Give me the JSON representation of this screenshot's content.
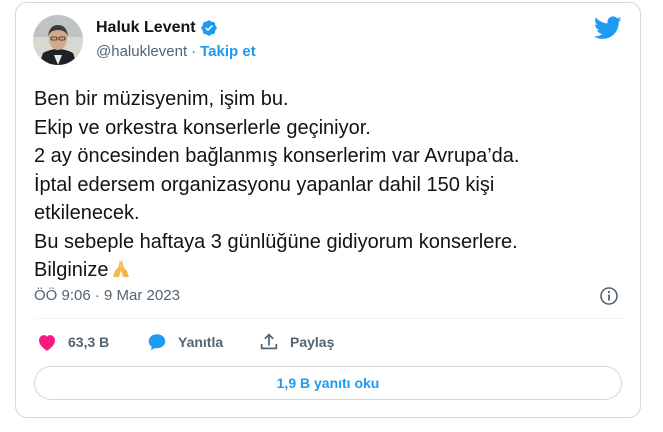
{
  "user": {
    "name": "Haluk Levent",
    "handle": "@haluklevent",
    "separator": "·",
    "follow_label": "Takip et"
  },
  "tweet": {
    "lines": [
      "Ben bir müzisyenim, işim bu.",
      "Ekip ve orkestra konserlerle geçiniyor.",
      "2 ay öncesinden bağlanmış konserlerim var Avrupa’da.",
      "İptal edersem organizasyonu yapanlar dahil 150 kişi",
      "etkilenecek.",
      "Bu sebeple haftaya 3 günlüğüne gidiyorum konserlere.",
      "Bilginize"
    ],
    "emoji": "folded-hands-icon",
    "timestamp": "ÖÖ 9:06 · 9 Mar 2023"
  },
  "actions": {
    "like_count": "63,3 B",
    "reply_label": "Yanıtla",
    "share_label": "Paylaş"
  },
  "replies_button": "1,9 B yanıtı oku",
  "colors": {
    "accent": "#1d9bf0",
    "like": "#f91880",
    "text": "#0f1419",
    "secondary": "#536471",
    "border": "#cfd9de"
  }
}
